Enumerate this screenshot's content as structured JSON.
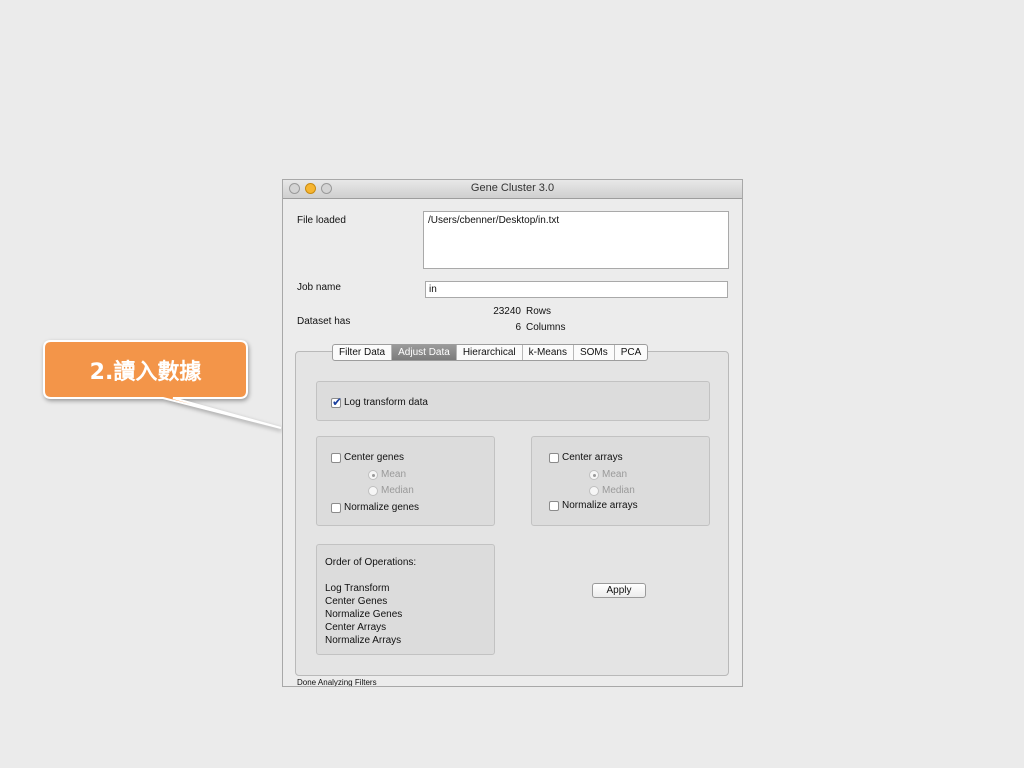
{
  "callout": {
    "text": "2.讀入數據",
    "color": "#f39549"
  },
  "window": {
    "title": "Gene Cluster 3.0"
  },
  "file": {
    "label": "File loaded",
    "value": "/Users/cbenner/Desktop/in.txt"
  },
  "job": {
    "label": "Job name",
    "value": "in"
  },
  "dataset": {
    "label": "Dataset has",
    "rows_count": "23240",
    "rows_label": "Rows",
    "cols_count": "6",
    "cols_label": "Columns"
  },
  "tabs": [
    {
      "label": "Filter Data",
      "active": false
    },
    {
      "label": "Adjust Data",
      "active": true
    },
    {
      "label": "Hierarchical",
      "active": false
    },
    {
      "label": "k-Means",
      "active": false
    },
    {
      "label": "SOMs",
      "active": false
    },
    {
      "label": "PCA",
      "active": false
    }
  ],
  "adjust": {
    "log_transform": {
      "label": "Log transform data",
      "checked": true
    },
    "center_genes": {
      "label": "Center genes",
      "checked": false
    },
    "genes_mean": "Mean",
    "genes_median": "Median",
    "normalize_genes": {
      "label": "Normalize genes",
      "checked": false
    },
    "center_arrays": {
      "label": "Center arrays",
      "checked": false
    },
    "arrays_mean": "Mean",
    "arrays_median": "Median",
    "normalize_arrays": {
      "label": "Normalize arrays",
      "checked": false
    },
    "order_title": "Order of Operations:",
    "order_steps": [
      "Log Transform",
      "Center Genes",
      "Normalize Genes",
      "Center Arrays",
      "Normalize Arrays"
    ],
    "apply_label": "Apply"
  },
  "status": "Done Analyzing Filters"
}
